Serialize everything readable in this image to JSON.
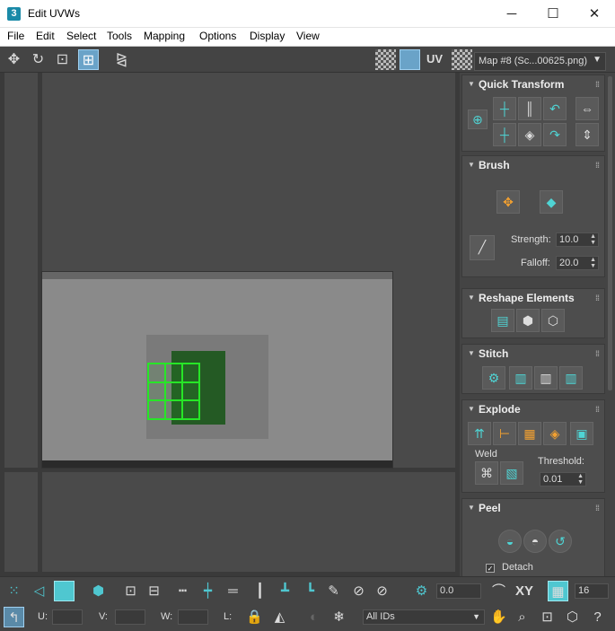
{
  "window": {
    "title": "Edit UVWs",
    "app_icon": "3",
    "minimize": "─",
    "maximize": "☐",
    "close": "✕"
  },
  "menu": [
    "File",
    "Edit",
    "Select",
    "Tools",
    "Mapping",
    "Options",
    "Display",
    "View"
  ],
  "toolbar": {
    "uv_label": "UV",
    "map_dropdown": "Map #8 (Sc...00625.png)"
  },
  "rollouts": {
    "quick_transform": "Quick Transform",
    "brush": "Brush",
    "reshape": "Reshape Elements",
    "stitch": "Stitch",
    "explode": "Explode",
    "peel": "Peel"
  },
  "brush": {
    "strength_label": "Strength:",
    "strength_value": "10.0",
    "falloff_label": "Falloff:",
    "falloff_value": "20.0"
  },
  "explode": {
    "weld_label": "Weld",
    "threshold_label": "Threshold:",
    "threshold_value": "0.01"
  },
  "peel": {
    "detach_label": "Detach",
    "detach_checked": true
  },
  "bottom": {
    "rotate_value": "0.0",
    "xy_label": "XY",
    "grid_value": "16",
    "u_label": "U:",
    "v_label": "V:",
    "w_label": "W:",
    "l_label": "L:",
    "ids_dropdown": "All IDs"
  },
  "colors": {
    "accent_teal": "#4fc7d0",
    "uv_selection": "#27e627",
    "panel_bg": "#444444"
  }
}
